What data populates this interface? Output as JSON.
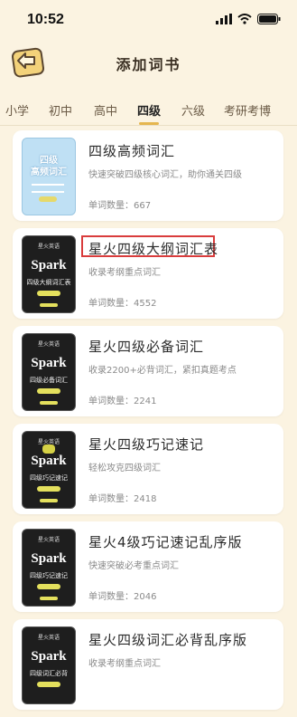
{
  "status": {
    "time": "10:52"
  },
  "header": {
    "title": "添加词书"
  },
  "tabs": [
    "小学",
    "初中",
    "高中",
    "四级",
    "六级",
    "考研考博"
  ],
  "active_tab": "四级",
  "books": [
    {
      "title": "四级高频词汇",
      "desc": "快速突破四级核心词汇，助你通关四级",
      "count": "单词数量：667",
      "cover": "blue",
      "cover_text": "四级\n高频词汇"
    },
    {
      "title": "星火四级大纲词汇表",
      "desc": "收录考纲重点词汇",
      "count": "单词数量：4552",
      "cover": "dark",
      "cover_text": "四级大纲词汇表",
      "highlight": true
    },
    {
      "title": "星火四级必备词汇",
      "desc": "收录2200+必背词汇，紧扣真题考点",
      "count": "单词数量：2241",
      "cover": "dark",
      "cover_text": "四级必备词汇"
    },
    {
      "title": "星火四级巧记速记",
      "desc": "轻松攻克四级词汇",
      "count": "单词数量：2418",
      "cover": "dark",
      "cover_text": "四级巧记速记"
    },
    {
      "title": "星火4级巧记速记乱序版",
      "desc": "快速突破必考重点词汇",
      "count": "单词数量：2046",
      "cover": "dark",
      "cover_text": "四级巧记速记"
    },
    {
      "title": "星火四级词汇必背乱序版",
      "desc": "收录考纲重点词汇",
      "count": "",
      "cover": "dark",
      "cover_text": "四级词汇必背"
    }
  ],
  "cover_brand": "Spark",
  "cover_top": "星火英语",
  "colors": {
    "background": "#fbf3e1",
    "tab_indicator": "#e5b64f",
    "highlight": "#d93c3c"
  }
}
